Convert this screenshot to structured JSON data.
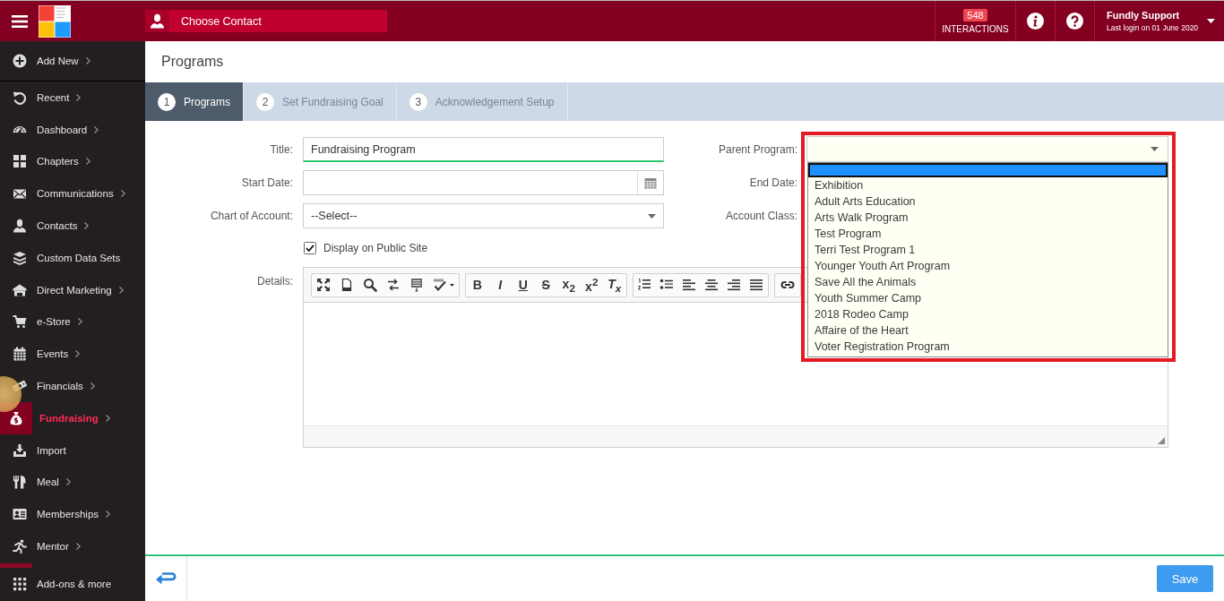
{
  "topbar": {
    "contact_button": "Choose Contact",
    "interactions": {
      "count": "548",
      "label": "INTERACTIONS"
    },
    "user": {
      "name": "Fundly Support",
      "last_login": "Last login on 01 June 2020"
    }
  },
  "sidebar": {
    "items": [
      {
        "label": "Add New",
        "submenu": true,
        "selected": false
      },
      {
        "label": "Recent",
        "submenu": true,
        "selected": false
      },
      {
        "label": "Dashboard",
        "submenu": true,
        "selected": false
      },
      {
        "label": "Chapters",
        "submenu": true,
        "selected": false
      },
      {
        "label": "Communications",
        "submenu": true,
        "selected": false
      },
      {
        "label": "Contacts",
        "submenu": true,
        "selected": false
      },
      {
        "label": "Custom Data Sets",
        "submenu": false,
        "selected": false
      },
      {
        "label": "Direct Marketing",
        "submenu": true,
        "selected": false
      },
      {
        "label": "e-Store",
        "submenu": true,
        "selected": false
      },
      {
        "label": "Events",
        "submenu": true,
        "selected": false
      },
      {
        "label": "Financials",
        "submenu": true,
        "selected": false
      },
      {
        "label": "Fundraising",
        "submenu": true,
        "selected": true
      },
      {
        "label": "Import",
        "submenu": false,
        "selected": false
      },
      {
        "label": "Meal",
        "submenu": true,
        "selected": false
      },
      {
        "label": "Memberships",
        "submenu": true,
        "selected": false
      },
      {
        "label": "Mentor",
        "submenu": true,
        "selected": false
      }
    ],
    "footer": "Add-ons & more"
  },
  "page": {
    "title": "Programs"
  },
  "steps": [
    {
      "number": "1",
      "label": "Programs",
      "selected": true
    },
    {
      "number": "2",
      "label": "Set Fundraising Goal",
      "selected": false
    },
    {
      "number": "3",
      "label": "Acknowledgement Setup",
      "selected": false
    }
  ],
  "form": {
    "fields": [
      {
        "kind": "text",
        "label": "Title:",
        "value": "Fundraising Program",
        "focused": true
      },
      {
        "kind": "date",
        "label": "Start Date:",
        "focused": false
      },
      {
        "kind": "select",
        "label": "Chart of Account:",
        "value": "--Select--",
        "focused": false
      }
    ],
    "display_on_public_site": {
      "label": "Display on Public Site",
      "checked": true
    },
    "parent_program": {
      "label": "Parent Program:",
      "open": true,
      "highlighted": true,
      "blank_option": {
        "selected": true
      },
      "options": [
        {
          "label": "Exhibition",
          "selected": false
        },
        {
          "label": "Adult Arts Education",
          "selected": false
        },
        {
          "label": "Arts Walk Program",
          "selected": false
        },
        {
          "label": "Test Program",
          "selected": false
        },
        {
          "label": "Terri Test Program 1",
          "selected": false
        },
        {
          "label": "Younger Youth Art Program",
          "selected": false
        },
        {
          "label": "Save All the Animals",
          "selected": false
        },
        {
          "label": "Youth Summer Camp",
          "selected": false
        },
        {
          "label": "2018 Rodeo Camp",
          "selected": false
        },
        {
          "label": "Affaire of the Heart",
          "selected": false
        },
        {
          "label": "Voter Registration Program",
          "selected": false
        }
      ]
    },
    "right_labels": [
      "End Date:",
      "Account Class:"
    ],
    "details": {
      "label": "Details:",
      "format_buttons": [
        "B",
        "I",
        "U",
        "S",
        "x$_{2}$",
        "x$^{2}$",
        "T$_{x}$"
      ]
    }
  },
  "footer": {
    "save_button": "Save"
  }
}
